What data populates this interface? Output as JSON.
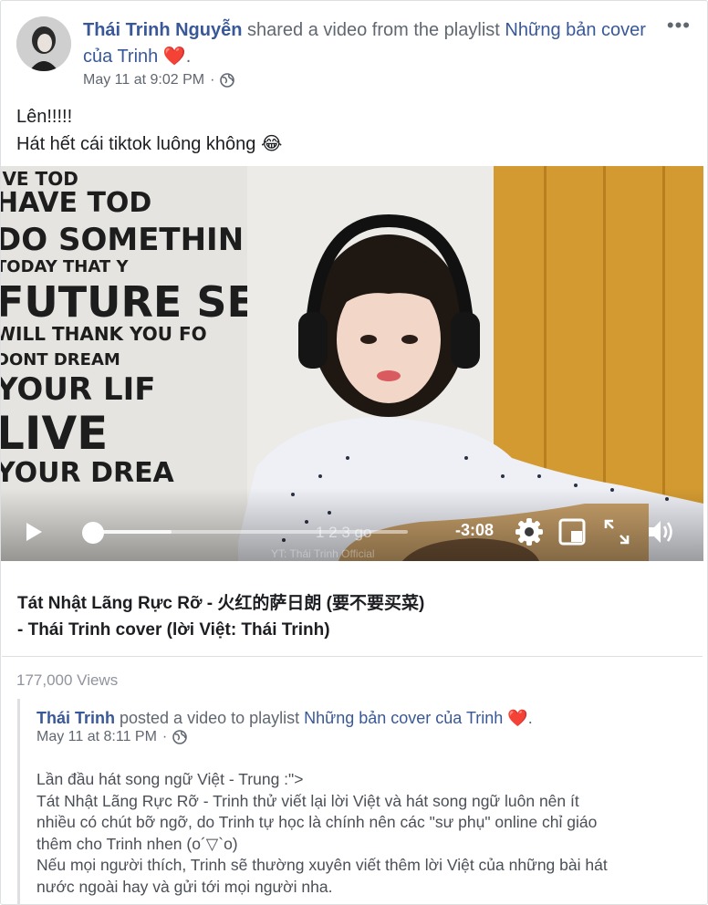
{
  "post": {
    "author": "Thái Trinh Nguyễn",
    "action_text": " shared a video from the playlist ",
    "playlist": "Những bản cover của Trinh",
    "heart": "❤️",
    "period": ".",
    "timestamp": "May 11 at 9:02 PM",
    "separator": "·",
    "more": "•••",
    "text_line1": "Lên!!!!!",
    "text_line2": "Hát hết cái tiktok luông không 😂"
  },
  "video": {
    "time_remaining": "-3:08",
    "caption_overlay": "1 2 3 go",
    "watermark": "YT: Thái Trinh Official",
    "title_line1": "Tát Nhật Lãng Rực Rỡ - 火红的萨日朗 (要不要买菜)",
    "title_line2": "- Thái Trinh cover (lời Việt: Thái Trinh)",
    "progress_played_fraction": 0.0,
    "progress_buffered_fraction": 0.25,
    "wall_lines": [
      "IVE TOD",
      "HAVE TOD",
      "DO SOMETHIN",
      "TODAY THAT Y",
      "FUTURE SE",
      "WILL THANK YOU FO",
      "DONT DREAM",
      "YOUR LIF",
      "LIVE",
      "YOUR DREA"
    ]
  },
  "views": "177,000 Views",
  "shared": {
    "author": "Thái Trinh",
    "action_text": " posted a video to playlist ",
    "playlist": "Những bản cover của Trinh",
    "heart": "❤️",
    "period": ".",
    "timestamp": "May 11 at 8:11 PM",
    "separator": "·",
    "body": [
      "Lần đầu hát song ngữ Việt - Trung :\">",
      "Tát Nhật Lãng Rực Rỡ - Trinh thử viết lại lời Việt và hát song ngữ luôn nên ít",
      "nhiều có chút bỡ ngỡ, do Trinh tự học là chính nên các \"sư phụ\" online chỉ giáo",
      "thêm cho Trinh nhen (o´▽`o)",
      "Nếu mọi người thích, Trinh sẽ thường xuyên viết thêm lời Việt của những bài hát",
      "nước ngoài hay và gửi tới mọi người nha."
    ]
  },
  "colors": {
    "link": "#385898",
    "meta": "#616770",
    "border": "#dddfe2",
    "cabinet": "#d39a31"
  }
}
